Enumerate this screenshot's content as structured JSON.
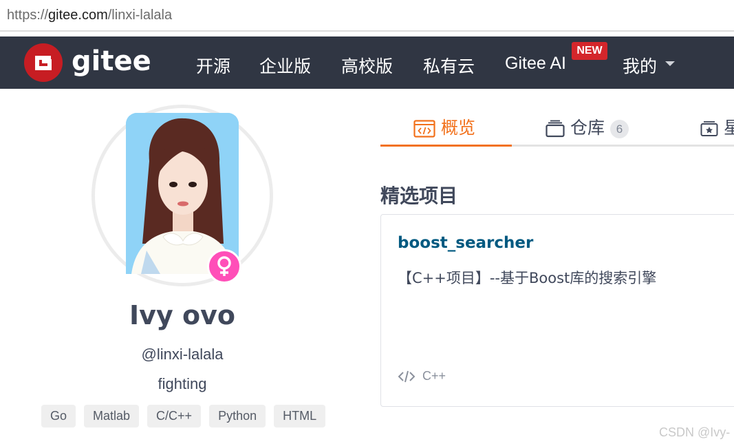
{
  "browser": {
    "url_scheme": "https://",
    "url_host": "gitee.com",
    "url_path": "/linxi-lalala"
  },
  "navbar": {
    "brand": "gitee",
    "items": [
      "开源",
      "企业版",
      "高校版",
      "私有云",
      "Gitee AI"
    ],
    "new_badge": "NEW",
    "mine": "我的",
    "background": "#303643",
    "brand_color": "#c71d23"
  },
  "profile": {
    "display_name": "Ivy ovo",
    "username": "@linxi-lalala",
    "bio": "fighting",
    "gender_icon": "female-icon",
    "tags": [
      "Go",
      "Matlab",
      "C/C++",
      "Python",
      "HTML"
    ]
  },
  "tabs": {
    "overview": "概览",
    "repos": "仓库",
    "repos_count": "6",
    "stars": "星",
    "accent": "#f2711c"
  },
  "featured": {
    "title": "精选项目",
    "project": {
      "name": "boost_searcher",
      "description": "【C++项目】--基于Boost库的搜索引擎",
      "language": "C++"
    }
  },
  "watermark": "CSDN @Ivy-"
}
